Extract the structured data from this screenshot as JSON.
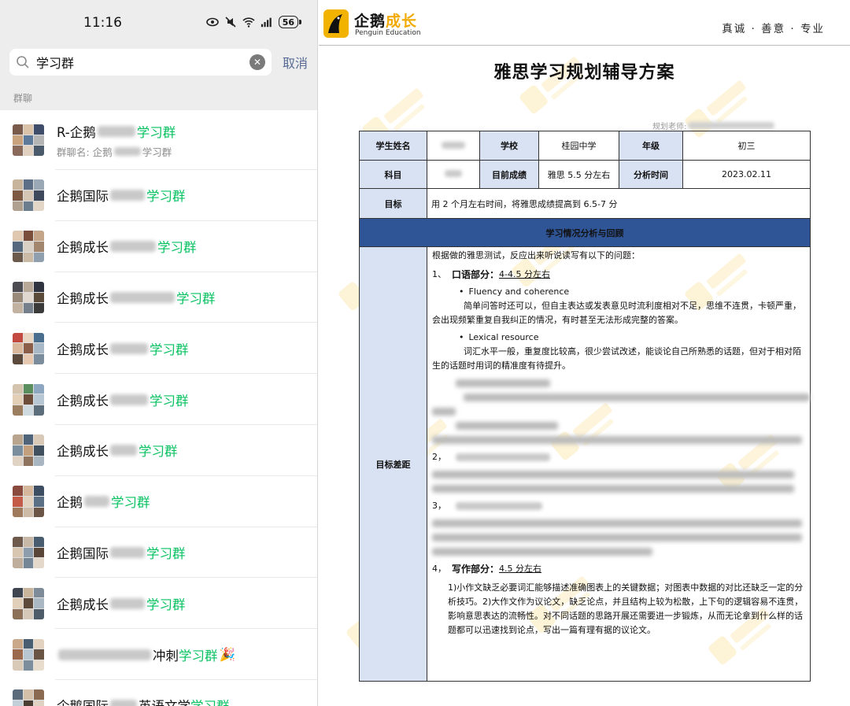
{
  "phone": {
    "status": {
      "time": "11:16",
      "battery": "56"
    },
    "search": {
      "query": "学习群",
      "cancel": "取消"
    },
    "section_label": "群聊",
    "chats": [
      {
        "prefix": "R-企鹅",
        "blur": 48,
        "highlight": "学习群",
        "suffix": "",
        "subtitle_prefix": "群聊名: 企鹅",
        "subtitle_highlight": "学习群",
        "colors": [
          "#7a5a4a",
          "#d9c2a8",
          "#3f4d6b",
          "#c9a27e",
          "#5e7a9a",
          "#b5b5b5",
          "#8a6a5a",
          "#e0d0c0",
          "#4b5a6a"
        ]
      },
      {
        "prefix": "企鹅国际",
        "blur": 44,
        "highlight": "学习群",
        "suffix": "",
        "colors": [
          "#c8b49a",
          "#5d6f86",
          "#9aa8b5",
          "#7e5a44",
          "#d4c5b5",
          "#3e4a5c",
          "#b0a090",
          "#6c7d8d",
          "#e3d6c6"
        ]
      },
      {
        "prefix": "企鹅成长 ",
        "blur": 58,
        "highlight": "学习群",
        "suffix": "",
        "colors": [
          "#e0c7b0",
          "#7a4e3a",
          "#c4a58a",
          "#55687d",
          "#d8d0c4",
          "#a3866e",
          "#6b5a4c",
          "#c9b9a5",
          "#8f9fae"
        ]
      },
      {
        "prefix": "企鹅成长",
        "blur": 82,
        "highlight": "学习群",
        "suffix": "",
        "colors": [
          "#4c4c52",
          "#b8a898",
          "#2f3440",
          "#9a8a7a",
          "#e1d9cf",
          "#5a4a3a",
          "#c2b2a2",
          "#75808c",
          "#3a3a3a"
        ]
      },
      {
        "prefix": "企鹅成长",
        "blur": 48,
        "highlight": "学习群",
        "suffix": "",
        "colors": [
          "#c24a3e",
          "#e8d5c2",
          "#4a6e8e",
          "#d8b79a",
          "#8b5e4a",
          "#a9b8c6",
          "#5c4a3c",
          "#e6c9b0",
          "#7b8c9c"
        ]
      },
      {
        "prefix": "企鹅成长",
        "blur": 48,
        "highlight": "学习群",
        "suffix": "",
        "colors": [
          "#d4c3ad",
          "#5a8e5e",
          "#8da7c0",
          "#e3cfb6",
          "#6d4e3a",
          "#b7c7d4",
          "#9c7e60",
          "#cfd9e0",
          "#5c6e7c"
        ]
      },
      {
        "prefix": "企鹅成长",
        "blur": 34,
        "highlight": "学习群",
        "suffix": "",
        "colors": [
          "#b9a48e",
          "#4f6478",
          "#d9c9b7",
          "#7a8e9e",
          "#c3a07d",
          "#41505e",
          "#e0d3c4",
          "#8f7460",
          "#a8b6c2"
        ]
      },
      {
        "prefix": "企鹅",
        "blur": 32,
        "highlight": "学习群",
        "suffix": "",
        "colors": [
          "#8a4a3e",
          "#d5b79c",
          "#3d4e62",
          "#c45a48",
          "#e2d1bf",
          "#5c7085",
          "#a07a5c",
          "#cdbba8",
          "#6b5546"
        ]
      },
      {
        "prefix": "企鹅国际",
        "blur": 44,
        "highlight": "学习群",
        "suffix": "",
        "colors": [
          "#6e5a4c",
          "#c8b8a8",
          "#4a5d70",
          "#d9c6b0",
          "#8d9dac",
          "#5a4638",
          "#bfae9c",
          "#758696",
          "#e4d8ca"
        ]
      },
      {
        "prefix": "企鹅成长",
        "blur": 44,
        "highlight": "学习群",
        "suffix": "",
        "colors": [
          "#3e4450",
          "#c9b49c",
          "#7e8c9a",
          "#e1cfba",
          "#5d4a3a",
          "#aab8c4",
          "#8c7058",
          "#d6c8b8",
          "#4e5c6a"
        ]
      },
      {
        "prefix": "",
        "blur": 118,
        "highlight": "学习群",
        "before_highlight": "冲刺",
        "suffix": "🎉",
        "colors": [
          "#c9a98a",
          "#4a5e72",
          "#e3d2bf",
          "#9b6a4e",
          "#b8c6d2",
          "#6a5444",
          "#d9cab8",
          "#7c8d9c",
          "#e8dccd"
        ]
      },
      {
        "prefix": "企鹅国际",
        "blur": 34,
        "highlight": "学习群",
        "before_highlight": "英语文学",
        "suffix": "",
        "colors": [
          "#5b6b7b",
          "#d4c0a8",
          "#8a6a50",
          "#c2ced8",
          "#4a3e34",
          "#e0d2c2",
          "#9aa8b4",
          "#b99c80",
          "#6e7e8e"
        ]
      }
    ]
  },
  "doc": {
    "logo": {
      "cn_main": "企鹅",
      "cn_accent": "成长",
      "en": "Penguin Education"
    },
    "tagline": "真诚 · 善意 · 专业",
    "title": "雅思学习规划辅导方案",
    "planner_label": "规划老师:",
    "table": {
      "student_name_label": "学生姓名",
      "school_label": "学校",
      "school_value": "桂园中学",
      "grade_label": "年级",
      "grade_value": "初三",
      "subject_label": "科目",
      "current_score_label": "目前成绩",
      "current_score_value": "雅思 5.5 分左右",
      "analysis_time_label": "分析时间",
      "analysis_time_value": "2023.02.11",
      "goal_label": "目标",
      "goal_value": "用 2 个月左右时间，将雅思成绩提高到 6.5-7 分",
      "section_banner": "学习情况分析与回顾",
      "gap_label": "目标差距",
      "intro": "根据做的雅思测试，反应出来听说读写有以下的问题：",
      "speaking_num": "1、",
      "speaking_title": "口语部分：",
      "speaking_score": "4-4.5 分左右",
      "fluency_label": "Fluency and coherence",
      "fluency_text": "简单问答时还可以，但自主表达或发表意见时流利度相对不足，思维不连贯，卡顿严重，会出现频繁重复自我纠正的情况，有时甚至无法形成完整的答案。",
      "lexical_label": "Lexical resource",
      "lexical_text": "词汇水平一般，重复度比较高，很少尝试改述，能谈论自己所熟悉的话题，但对于相对陌生的话题时用词的精准度有待提升。",
      "reading_num": "2，",
      "listening_num": "3，",
      "writing_num": "4，",
      "writing_title": "写作部分：",
      "writing_score": "4.5 分左右",
      "writing_text": "1)小作文缺乏必要词汇能够描述准确图表上的关键数据；对图表中数据的对比还缺乏一定的分析技巧。2)大作文作为议论文，缺乏论点，并且结构上较为松散，上下句的逻辑容易不连贯，影响意思表达的流畅性。对不同话题的思路开展还需要进一步锻炼，从而无论拿到什么样的话题都可以迅速找到论点，写出一篇有理有据的议论文。"
    }
  }
}
